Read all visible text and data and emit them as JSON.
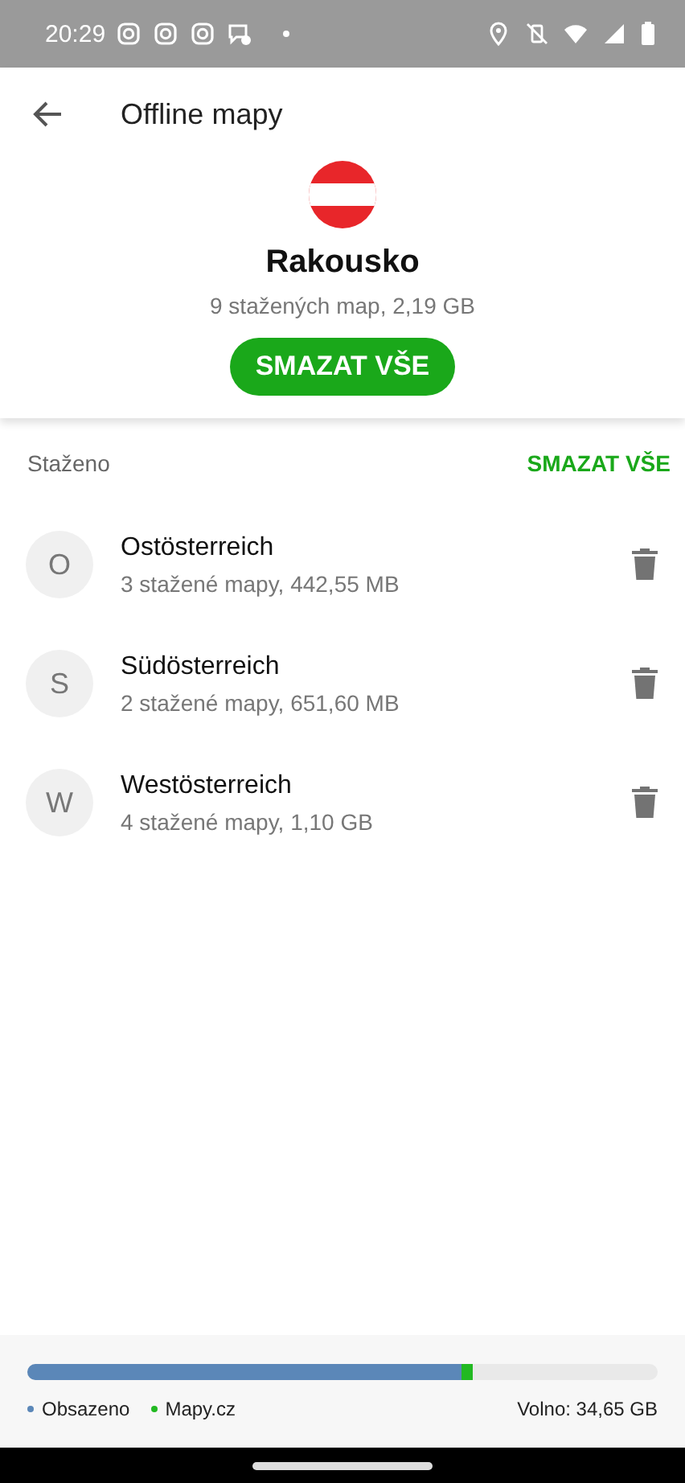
{
  "status_bar": {
    "time": "20:29"
  },
  "toolbar": {
    "title": "Offline mapy"
  },
  "country": {
    "name": "Rakousko",
    "summary": "9 stažených map, 2,19 GB",
    "button": "SMAZAT VŠE"
  },
  "section": {
    "title": "Staženo",
    "action": "SMAZAT VŠE"
  },
  "regions": [
    {
      "initial": "O",
      "name": "Ostösterreich",
      "detail": "3 stažené mapy, 442,55 MB"
    },
    {
      "initial": "S",
      "name": "Südösterreich",
      "detail": "2 stažené mapy, 651,60 MB"
    },
    {
      "initial": "W",
      "name": "Westösterreich",
      "detail": "4 stažené mapy, 1,10 GB"
    }
  ],
  "storage": {
    "segments": [
      {
        "label": "Obsazeno",
        "color": "#5b87b8",
        "level": 0.689
      },
      {
        "label": "Mapy.cz",
        "color": "#22b922"
      }
    ],
    "free": "Volno: 34,65 GB"
  }
}
